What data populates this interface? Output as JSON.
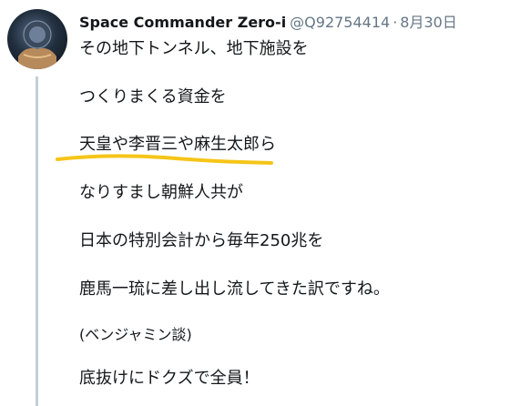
{
  "tweet": {
    "display_name": "Space Commander Zero-i",
    "handle": "@Q92754414",
    "separator": "·",
    "date": "8月30日",
    "lines": [
      "その地下トンネル、地下施設を",
      "つくりまくる資金を",
      "天皇や李晋三や麻生太郎ら",
      "なりすまし朝鮮人共が",
      "日本の特別会計から毎年250兆を",
      "鹿馬一琉に差し出し流してきた訳ですね。",
      "(ベンジャミン談)",
      "底抜けにドクズで全員！"
    ],
    "highlight_color": "#f5c518",
    "thread_line_color": "#c4cfd6"
  }
}
